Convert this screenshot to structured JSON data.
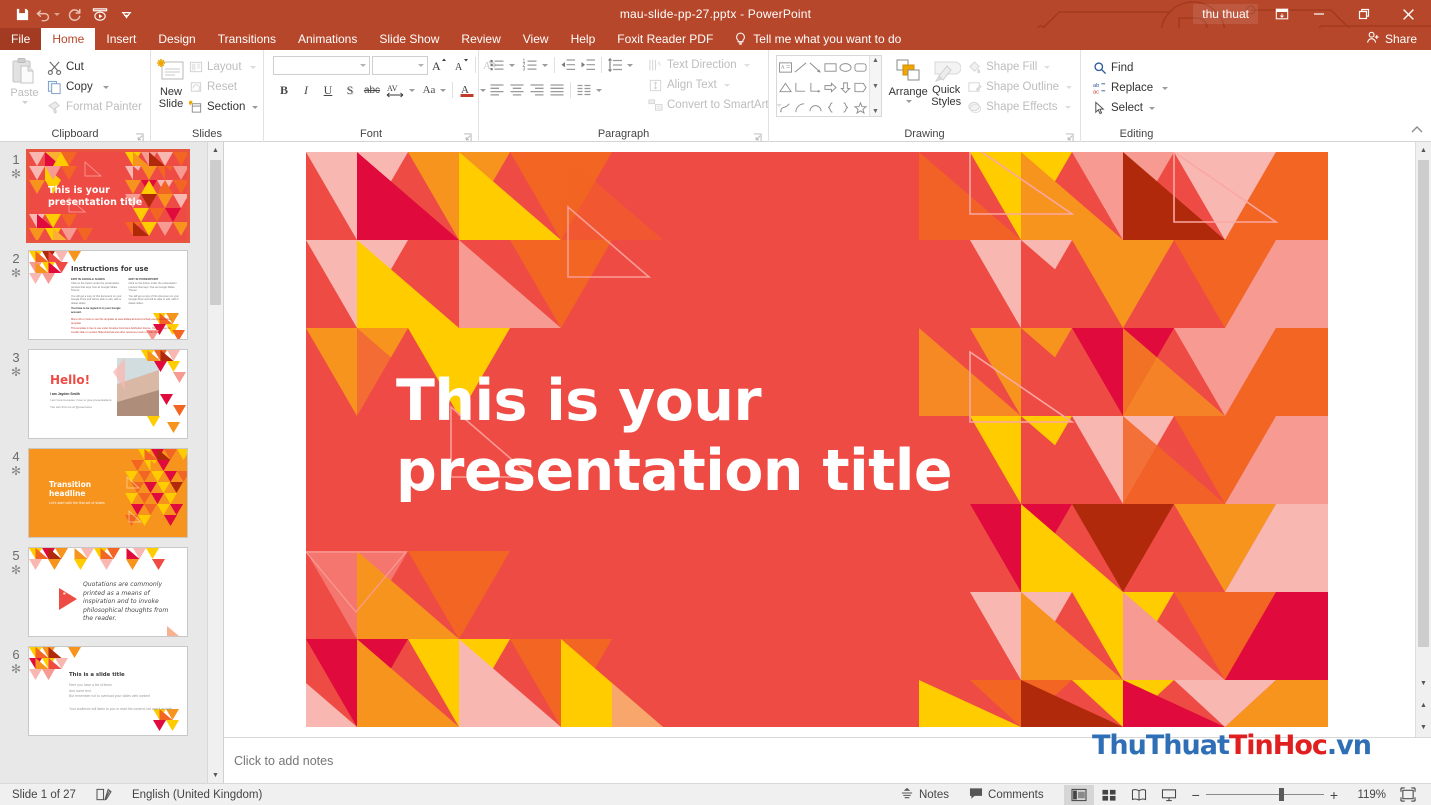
{
  "window": {
    "title": "mau-slide-pp-27.pptx  -  PowerPoint",
    "user": "thu thuat",
    "minimize_label": "Minimize",
    "restore_label": "Restore",
    "close_label": "Close",
    "ribbon_display_label": "Ribbon Display Options"
  },
  "quick_access": [
    {
      "name": "save",
      "label": "Save"
    },
    {
      "name": "undo",
      "label": "Undo"
    },
    {
      "name": "redo",
      "label": "Redo"
    },
    {
      "name": "start-from-beginning",
      "label": "Start From Beginning"
    },
    {
      "name": "customize-qat",
      "label": "Customize Quick Access Toolbar"
    }
  ],
  "tabs": [
    {
      "label": "File",
      "active": false
    },
    {
      "label": "Home",
      "active": true
    },
    {
      "label": "Insert",
      "active": false
    },
    {
      "label": "Design",
      "active": false
    },
    {
      "label": "Transitions",
      "active": false
    },
    {
      "label": "Animations",
      "active": false
    },
    {
      "label": "Slide Show",
      "active": false
    },
    {
      "label": "Review",
      "active": false
    },
    {
      "label": "View",
      "active": false
    },
    {
      "label": "Help",
      "active": false
    },
    {
      "label": "Foxit Reader PDF",
      "active": false
    }
  ],
  "tellme": {
    "placeholder": "Tell me what you want to do"
  },
  "share": {
    "label": "Share"
  },
  "ribbon": {
    "clipboard": {
      "group_label": "Clipboard",
      "paste_label": "Paste",
      "cut_label": "Cut",
      "copy_label": "Copy",
      "format_painter_label": "Format Painter"
    },
    "slides": {
      "group_label": "Slides",
      "new_slide_label_line1": "New",
      "new_slide_label_line2": "Slide",
      "layout_label": "Layout",
      "reset_label": "Reset",
      "section_label": "Section"
    },
    "font": {
      "group_label": "Font",
      "font_name_value": "",
      "font_name_placeholder": "",
      "font_size_value": "",
      "grow_font_label": "A",
      "shrink_font_label": "A",
      "clear_formatting_label": "Clear All Formatting",
      "bold_label": "B",
      "italic_label": "I",
      "underline_label": "U",
      "shadow_label": "S",
      "strikethrough_label": "abc",
      "character_spacing_label": "AV",
      "change_case_label": "Aa",
      "font_color_label": "A"
    },
    "paragraph": {
      "group_label": "Paragraph",
      "text_direction_label": "Text Direction",
      "align_text_label": "Align Text",
      "convert_smartart_label": "Convert to SmartArt"
    },
    "drawing": {
      "group_label": "Drawing",
      "arrange_label": "Arrange",
      "quick_styles_line1": "Quick",
      "quick_styles_line2": "Styles",
      "shape_fill_label": "Shape Fill",
      "shape_outline_label": "Shape Outline",
      "shape_effects_label": "Shape Effects"
    },
    "editing": {
      "group_label": "Editing",
      "find_label": "Find",
      "replace_label": "Replace",
      "select_label": "Select"
    }
  },
  "thumbnails": [
    {
      "number": "1",
      "modified": "✻",
      "selected": true,
      "kind": "title",
      "title": "This is your presentation title"
    },
    {
      "number": "2",
      "modified": "✻",
      "selected": false,
      "kind": "instructions",
      "title": "Instructions for use",
      "col1_head": "EDIT IN GOOGLE SLIDES",
      "col2_head": "EDIT IN POWERPOINT",
      "body1": "Click on the button under the presentation preview that says 'Use as Google Slides Theme'.",
      "body2": "You will get a copy of this document on your Google Drive and will be able to edit, add or delete slides.",
      "body3": "You have to be signed in to your Google account.",
      "note1": "More info on how to use this template at www.slidescarnival.com/help-use-presentation-template",
      "note2": "This template is free to use under Creative Commons Attribution license. You can keep the Credits slide or mention SlidesCarnival and other resources used in a slide footer."
    },
    {
      "number": "3",
      "modified": "✻",
      "selected": false,
      "kind": "hello",
      "title": "Hello!",
      "sub": "I am Jayden Smith",
      "body": "I am here because I love to give presentations.",
      "body2": "You can find me at @username"
    },
    {
      "number": "4",
      "modified": "✻",
      "selected": false,
      "kind": "transition",
      "title": "Transition headline",
      "sub": "Let's start with the first set of slides"
    },
    {
      "number": "5",
      "modified": "✻",
      "selected": false,
      "kind": "quote",
      "quote": "Quotations are commonly printed as a means of inspiration and to invoke philosophical thoughts from the reader."
    },
    {
      "number": "6",
      "modified": "✻",
      "selected": false,
      "kind": "bullets",
      "title": "This is a slide title",
      "b1": "Here you have a list of items",
      "b2": "And some text",
      "b3": "But remember not to overload your slides with content",
      "foot": "Your audience will listen to you or read the content, but won't do both."
    }
  ],
  "slide": {
    "title_line1": "This is your",
    "title_line2": "presentation title",
    "background_color": "#ef4b45",
    "palette": {
      "red": "#ef4b45",
      "crimson": "#e00a3c",
      "darkred": "#b0290a",
      "orange": "#f7941e",
      "orange_deep": "#f26522",
      "yellow": "#ffcc00",
      "gold": "#fbb034",
      "pink": "#f79a92",
      "pink_light": "#f9b7b2",
      "white": "#ffffff"
    }
  },
  "notes": {
    "placeholder": "Click to add notes"
  },
  "statusbar": {
    "slide_counter": "Slide 1 of 27",
    "language": "English (United Kingdom)",
    "notes_label": "Notes",
    "comments_label": "Comments",
    "zoom_percent": "119%",
    "zoom_out_label": "−",
    "zoom_in_label": "+",
    "views": [
      {
        "name": "normal-view",
        "on": true
      },
      {
        "name": "slide-sorter-view",
        "on": false
      },
      {
        "name": "reading-view",
        "on": false
      },
      {
        "name": "slide-show-view",
        "on": false
      }
    ]
  },
  "watermark": {
    "part1": "ThuThuat",
    "part2": "TinHoc",
    "part3": ".vn"
  }
}
